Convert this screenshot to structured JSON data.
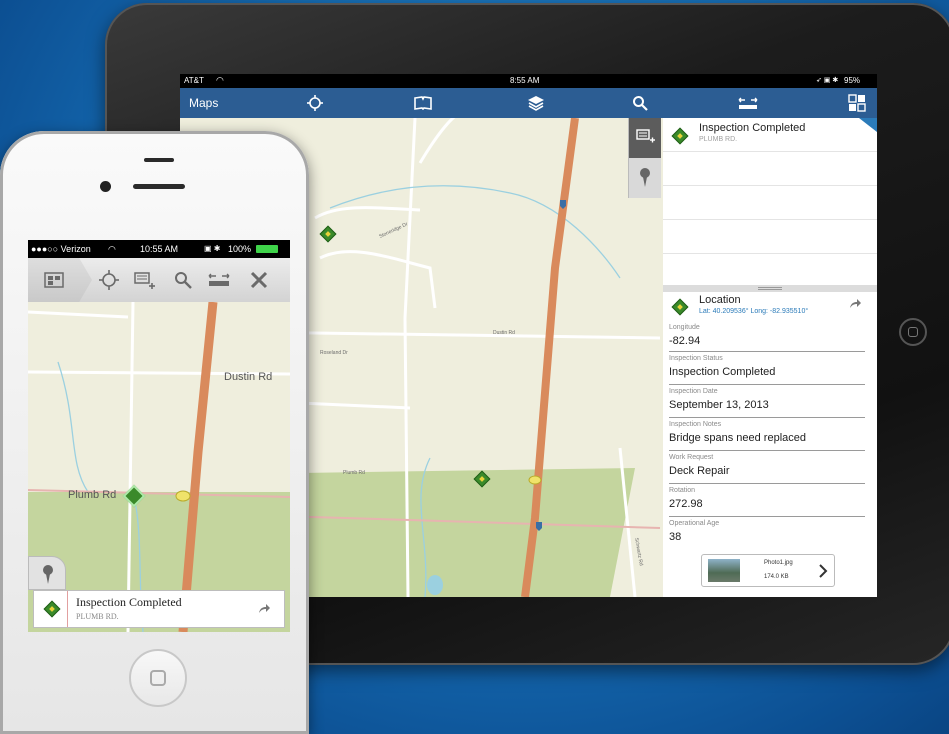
{
  "ipad": {
    "status": {
      "carrier": "AT&T",
      "time": "8:55 AM",
      "battery": "95%"
    },
    "nav": {
      "title": "Maps",
      "icons": [
        "locate-icon",
        "bookmarks-icon",
        "layers-icon",
        "search-icon",
        "measure-icon",
        "basemap-icon"
      ]
    },
    "map": {
      "street_labels": [
        "Dustin Rd",
        "Roseland Dr",
        "Plumb Rd",
        "Stoneridge Dr",
        "Schwartz Rd"
      ],
      "shield_label": "71"
    },
    "side_tabs": [
      "collect-feature-icon",
      "map-pin-icon"
    ],
    "list": {
      "items": [
        {
          "title": "Inspection Completed",
          "subtitle": "PLUMB RD."
        }
      ]
    },
    "detail": {
      "title": "Location",
      "coords": "Lat: 40.209536° Long: -82.935510°",
      "fields": [
        {
          "label": "Longitude",
          "value": "-82.94"
        },
        {
          "label": "Inspection Status",
          "value": "Inspection Completed"
        },
        {
          "label": "Inspection Date",
          "value": "September 13, 2013"
        },
        {
          "label": "Inspection Notes",
          "value": "Bridge spans need replaced"
        },
        {
          "label": "Work Request",
          "value": "Deck Repair"
        },
        {
          "label": "Rotation",
          "value": "272.98"
        },
        {
          "label": "Operational Age",
          "value": "38"
        }
      ],
      "attachment": {
        "name": "Photo1.jpg",
        "size": "174.0 KB"
      }
    }
  },
  "iphone": {
    "status": {
      "carrier": "●●●○○ Verizon",
      "time": "10:55 AM",
      "battery": "100%"
    },
    "toolbar_icons": [
      "map-list-icon",
      "locate-icon",
      "collect-feature-icon",
      "search-icon",
      "measure-icon",
      "tools-icon"
    ],
    "map": {
      "street_labels": [
        "Dustin Rd",
        "Plumb Rd"
      ]
    },
    "callout": {
      "title": "Inspection Completed",
      "subtitle": "PLUMB RD."
    }
  },
  "colors": {
    "nav_bar": "#2c5d93",
    "map_background": "#efeedd",
    "highway": "#d98a5c",
    "park": "#c4d59e",
    "feature_marker": "#3a8a2a",
    "link_blue": "#2b7bb9"
  }
}
